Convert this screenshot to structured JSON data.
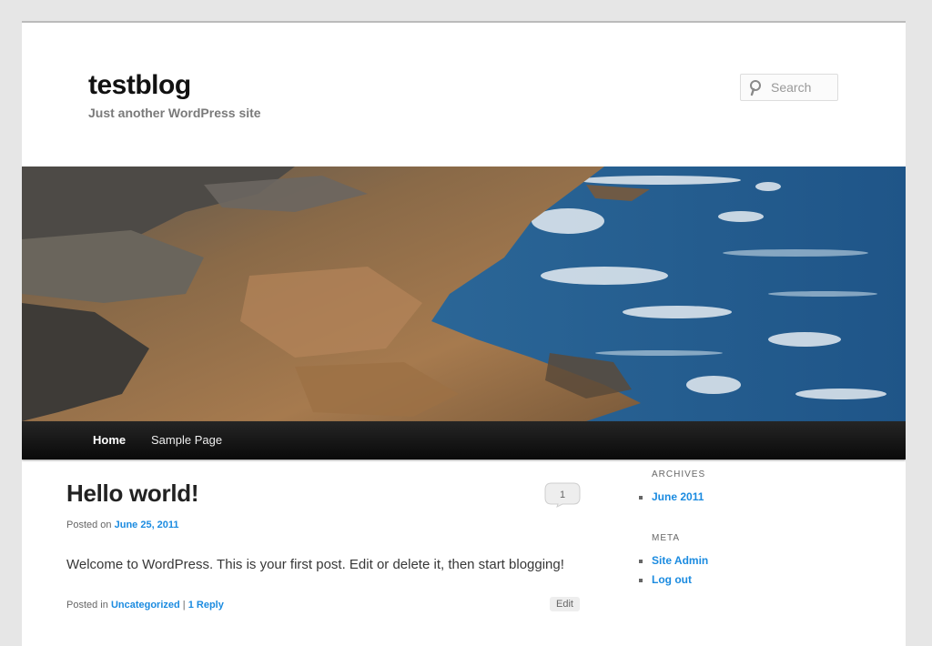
{
  "site": {
    "title": "testblog",
    "description": "Just another WordPress site"
  },
  "search": {
    "placeholder": "Search"
  },
  "nav": {
    "items": [
      {
        "label": "Home"
      },
      {
        "label": "Sample Page"
      }
    ]
  },
  "post": {
    "title": "Hello world!",
    "comment_count": "1",
    "posted_on_prefix": "Posted on",
    "date": "June 25, 2011",
    "content": "Welcome to WordPress. This is your first post. Edit or delete it, then start blogging!",
    "posted_in_prefix": "Posted in",
    "category": "Uncategorized",
    "separator": "|",
    "replies": "1 Reply",
    "edit_label": "Edit"
  },
  "sidebar": {
    "archives_title": "ARCHIVES",
    "archives": [
      "June 2011"
    ],
    "meta_title": "META",
    "meta_links": [
      "Site Admin",
      "Log out"
    ]
  },
  "colors": {
    "link": "#1b8be0",
    "nav_background": "#111111",
    "page_background": "#e6e6e6"
  },
  "icons": {
    "search": "magnifier-icon",
    "comment": "speech-bubble-icon"
  }
}
